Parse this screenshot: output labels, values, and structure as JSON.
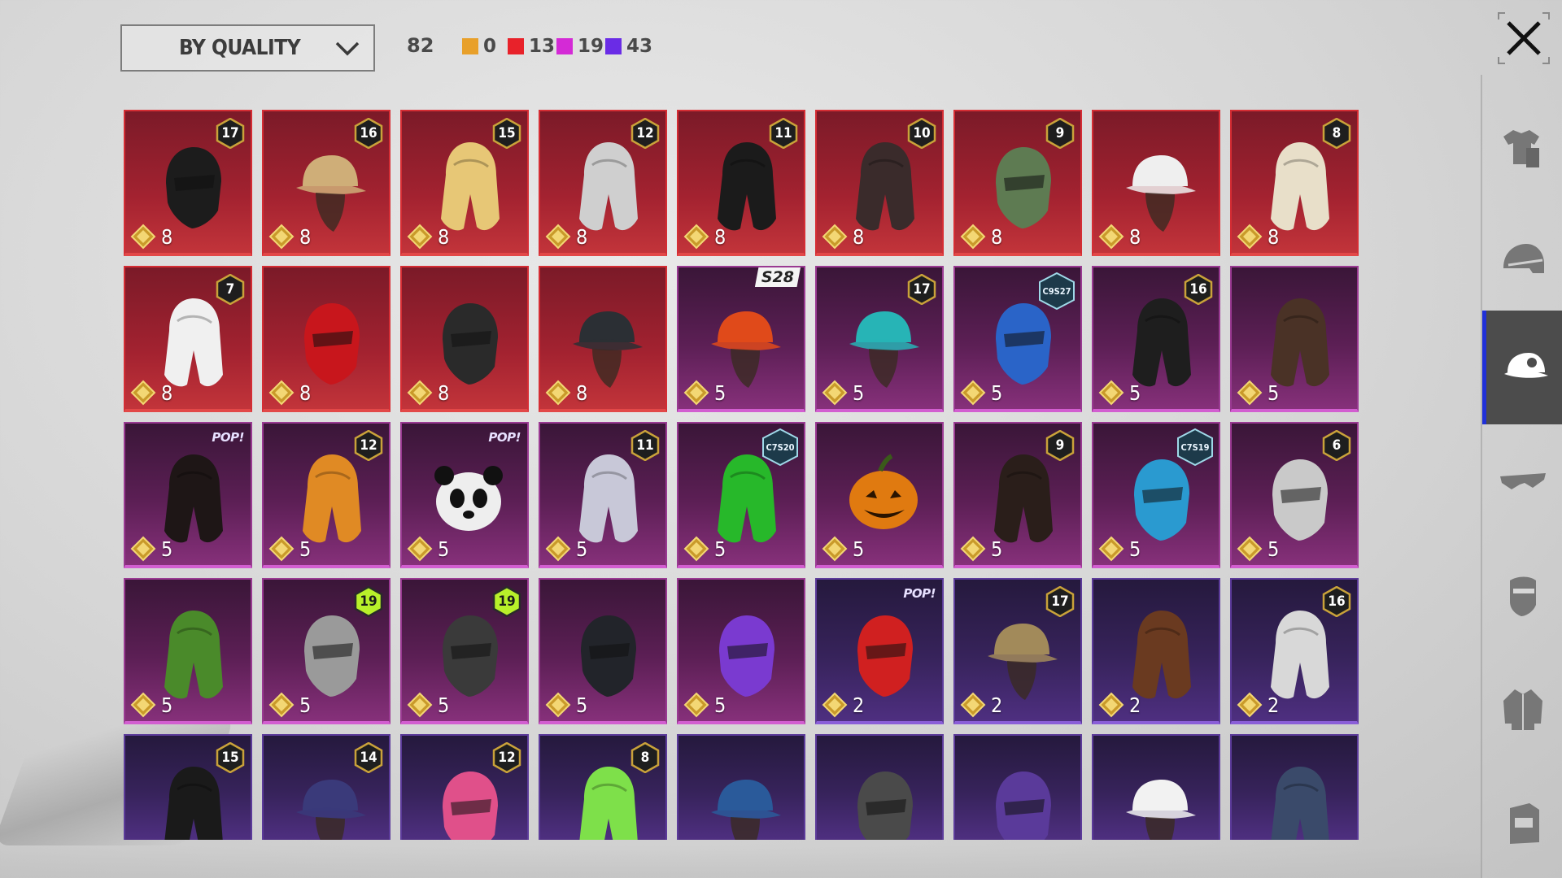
{
  "filter": {
    "label": "BY QUALITY",
    "icon": "chevron-down-icon"
  },
  "counts": {
    "total": "82",
    "qualities": [
      {
        "color": "#e8a02a",
        "value": "0"
      },
      {
        "color": "#e8222a",
        "value": "13"
      },
      {
        "color": "#d42ad6",
        "value": "19"
      },
      {
        "color": "#6a2ce6",
        "value": "43"
      }
    ]
  },
  "close_icon": "close-icon",
  "sidebar": [
    {
      "icon": "outfit-icon",
      "active": false
    },
    {
      "icon": "helmet-icon",
      "active": false
    },
    {
      "icon": "cap-icon",
      "active": true
    },
    {
      "icon": "glasses-icon",
      "active": false
    },
    {
      "icon": "mask-icon",
      "active": false
    },
    {
      "icon": "jacket-icon",
      "active": false
    },
    {
      "icon": "backpack-icon",
      "active": false
    }
  ],
  "items": [
    {
      "quality": "red",
      "level": "17",
      "price": "8",
      "art": "masked-hood",
      "color": "#1c1c1c"
    },
    {
      "quality": "red",
      "level": "16",
      "price": "8",
      "art": "goggle-hat",
      "color": "#cfae78"
    },
    {
      "quality": "red",
      "level": "15",
      "price": "8",
      "art": "blonde-pink-hair",
      "color": "#e7c776"
    },
    {
      "quality": "red",
      "level": "12",
      "price": "8",
      "art": "silver-hair",
      "color": "#cfcfcf"
    },
    {
      "quality": "red",
      "level": "11",
      "price": "8",
      "art": "black-short-hair",
      "color": "#1b1b1b"
    },
    {
      "quality": "red",
      "level": "10",
      "price": "8",
      "art": "brown-braided-hair",
      "color": "#3a2b2b"
    },
    {
      "quality": "red",
      "level": "9",
      "price": "8",
      "art": "zombie-head",
      "color": "#5e7b52"
    },
    {
      "quality": "red",
      "level": "",
      "price": "8",
      "art": "white-cowboy-hat",
      "color": "#efefef"
    },
    {
      "quality": "red",
      "level": "8",
      "price": "8",
      "art": "blonde-bob",
      "color": "#e8dfc9"
    },
    {
      "quality": "red",
      "level": "7",
      "price": "8",
      "art": "white-long-hair",
      "color": "#f0f0f0"
    },
    {
      "quality": "red",
      "level": "",
      "price": "8",
      "art": "red-helmet",
      "color": "#c8161c"
    },
    {
      "quality": "red",
      "level": "",
      "price": "8",
      "art": "oni-mask-helmet",
      "color": "#2a2a2a"
    },
    {
      "quality": "red",
      "level": "",
      "price": "8",
      "art": "visor-cap-mask",
      "color": "#2b2f34"
    },
    {
      "quality": "pink",
      "season": "S28",
      "price": "5",
      "art": "lion-dance-hat",
      "color": "#e04a1a"
    },
    {
      "quality": "pink",
      "level": "17",
      "price": "5",
      "art": "teal-cap-blonde",
      "color": "#27b4b6"
    },
    {
      "quality": "pink",
      "code": "C9S27",
      "price": "5",
      "art": "horned-headphones",
      "color": "#2a64c8"
    },
    {
      "quality": "pink",
      "level": "16",
      "price": "5",
      "art": "black-long-hair-band",
      "color": "#1e1e1e"
    },
    {
      "quality": "pink",
      "level": "",
      "price": "5",
      "art": "brown-shag-hair",
      "color": "#4a3226"
    },
    {
      "quality": "pink",
      "pop": "POP!",
      "price": "5",
      "art": "dark-pigtails",
      "color": "#1e1616"
    },
    {
      "quality": "pink",
      "level": "12",
      "price": "5",
      "art": "orange-pigtails",
      "color": "#e08a24"
    },
    {
      "quality": "pink",
      "pop": "POP!",
      "price": "5",
      "art": "panda-head",
      "color": "#eeeeee"
    },
    {
      "quality": "pink",
      "level": "11",
      "price": "5",
      "art": "flower-crown-hair",
      "color": "#c8c8d8"
    },
    {
      "quality": "pink",
      "code": "C7S20",
      "price": "5",
      "art": "green-pigtails",
      "color": "#27b82a"
    },
    {
      "quality": "pink",
      "level": "",
      "price": "5",
      "art": "pumpkin-head",
      "color": "#e07a10"
    },
    {
      "quality": "pink",
      "level": "9",
      "price": "5",
      "art": "long-dark-hair",
      "color": "#2a1e1a"
    },
    {
      "quality": "pink",
      "code": "C7S19",
      "price": "5",
      "art": "feathered-headdress",
      "color": "#2a9ad0"
    },
    {
      "quality": "pink",
      "level": "6",
      "price": "5",
      "art": "gold-silver-mask",
      "color": "#c9c9c9"
    },
    {
      "quality": "pink",
      "level": "",
      "price": "5",
      "art": "feather-warbonnet",
      "color": "#4a8a2a"
    },
    {
      "quality": "pink",
      "level": "19",
      "levelColor": "green",
      "price": "5",
      "art": "grey-ear-headphones",
      "color": "#9a9a9a"
    },
    {
      "quality": "pink",
      "level": "19",
      "levelColor": "green",
      "price": "5",
      "art": "goggle-eyes-helmet",
      "color": "#3a3a3a"
    },
    {
      "quality": "pink",
      "level": "",
      "price": "5",
      "art": "visor-helmet",
      "color": "#22242a"
    },
    {
      "quality": "pink",
      "level": "",
      "price": "5",
      "art": "purple-tech-mask",
      "color": "#7a3ad0"
    },
    {
      "quality": "purple",
      "pop": "POP!",
      "price": "2",
      "art": "heart-headband",
      "color": "#d02020"
    },
    {
      "quality": "purple",
      "level": "17",
      "price": "2",
      "art": "straw-hat-mask",
      "color": "#a28a5a"
    },
    {
      "quality": "purple",
      "level": "",
      "price": "2",
      "art": "brown-ponytail",
      "color": "#6a3a20"
    },
    {
      "quality": "purple",
      "level": "16",
      "price": "2",
      "art": "beanie-goggles",
      "color": "#d8d8d8"
    },
    {
      "quality": "purple",
      "level": "15",
      "price": "",
      "art": "jack-o-beanie",
      "color": "#1a1a1a"
    },
    {
      "quality": "purple",
      "level": "14",
      "price": "",
      "art": "cat-ear-cap",
      "color": "#3a3a7a"
    },
    {
      "quality": "purple",
      "level": "12",
      "price": "",
      "art": "bunny-ear-helmet",
      "color": "#e0508a"
    },
    {
      "quality": "purple",
      "level": "8",
      "price": "",
      "art": "green-skull-hood",
      "color": "#7ee04a"
    },
    {
      "quality": "purple",
      "level": "",
      "price": "",
      "art": "blue-baseball-cap",
      "color": "#2a5a9a"
    },
    {
      "quality": "purple",
      "level": "",
      "price": "",
      "art": "grey-bump-helmet",
      "color": "#4a4a4a"
    },
    {
      "quality": "purple",
      "level": "",
      "price": "",
      "art": "purple-tech-helmet",
      "color": "#5a3a9a"
    },
    {
      "quality": "purple",
      "level": "",
      "price": "",
      "art": "white-sun-hat",
      "color": "#f2f2f2"
    },
    {
      "quality": "purple",
      "level": "",
      "price": "",
      "art": "navy-beanie",
      "color": "#3a4a6a"
    }
  ]
}
